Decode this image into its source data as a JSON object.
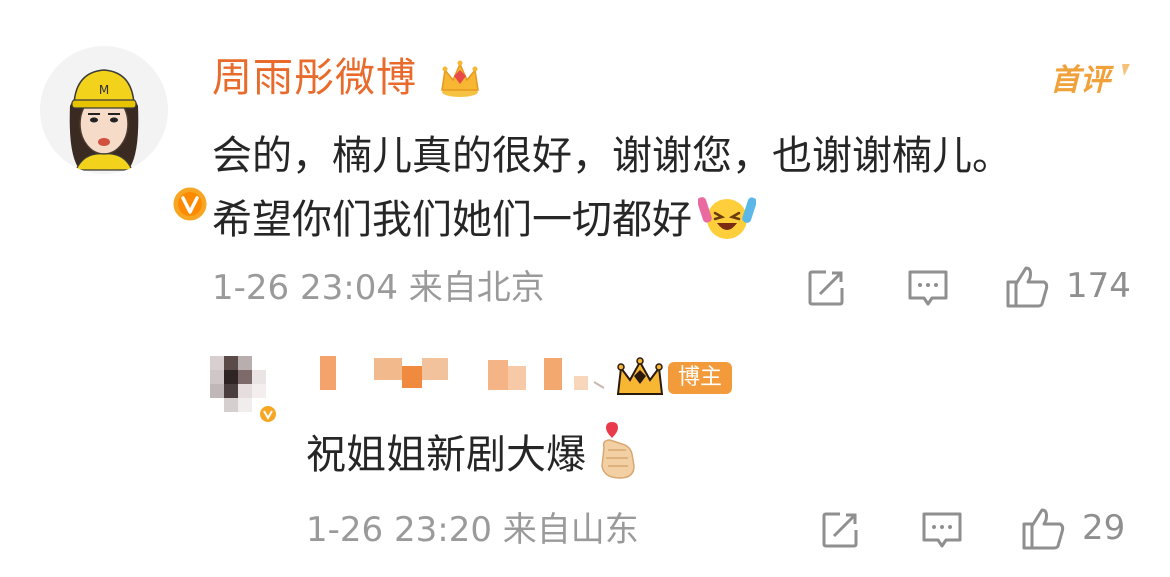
{
  "comment": {
    "username": "周雨彤微博",
    "first_comment_label": "首评",
    "text_line1": "会的，楠儿真的很好，谢谢您，也谢谢楠儿。",
    "text_line2": "希望你们我们她们一切都好",
    "date": "1-26",
    "time": "23:04",
    "location": "来自北京",
    "like_count": "174",
    "icons": [
      "crown-icon",
      "verified-v-icon",
      "laughing-tears-emoji",
      "share-icon",
      "comment-icon",
      "thumbs-up-icon"
    ]
  },
  "reply": {
    "badge_label": "博主",
    "text": "祝姐姐新剧大爆",
    "date": "1-26",
    "time": "23:20",
    "location": "来自山东",
    "like_count": "29",
    "icons": [
      "crown-icon",
      "finger-heart-emoji",
      "share-icon",
      "comment-icon",
      "thumbs-up-icon"
    ]
  },
  "colors": {
    "username": "#e86b2c",
    "meta": "#9a9a9a",
    "badge": "#f39a3a",
    "text": "#262626"
  }
}
